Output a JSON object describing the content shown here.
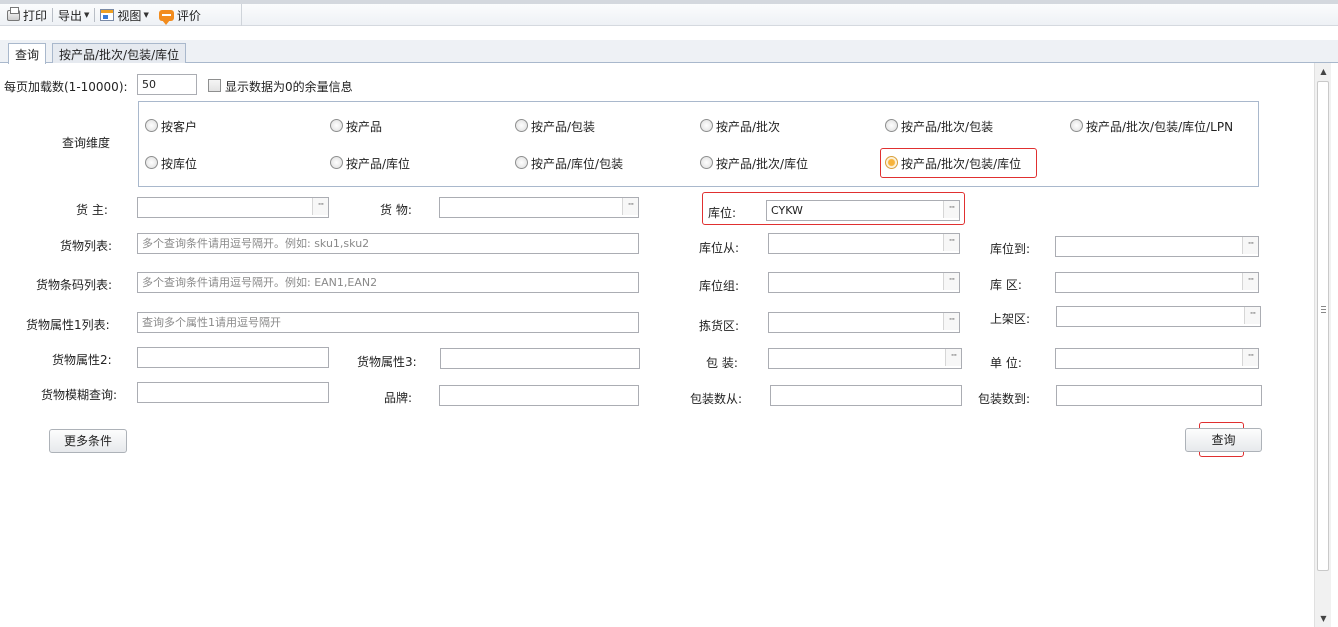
{
  "toolbar": {
    "print": "打印",
    "export": "导出",
    "view": "视图",
    "rate": "评价"
  },
  "tabs": [
    "查询",
    "按产品/批次/包装/库位"
  ],
  "page_size": {
    "label": "每页加载数(1-10000):",
    "value": "50"
  },
  "show_zero": {
    "label": "显示数据为0的余量信息",
    "checked": false
  },
  "dimension": {
    "label": "查询维度",
    "options": [
      "按客户",
      "按产品",
      "按产品/包装",
      "按产品/批次",
      "按产品/批次/包装",
      "按产品/批次/包装/库位/LPN",
      "按库位",
      "按产品/库位",
      "按产品/库位/包装",
      "按产品/批次/库位",
      "按产品/批次/包装/库位"
    ],
    "selected": "按产品/批次/包装/库位"
  },
  "fields": {
    "owner": {
      "label": "货 主:",
      "value": ""
    },
    "goods": {
      "label": "货 物:",
      "value": ""
    },
    "location": {
      "label": "库位:",
      "value": "CYKW"
    },
    "goods_list": {
      "label": "货物列表:",
      "placeholder": "多个查询条件请用逗号隔开。例如: sku1,sku2"
    },
    "location_from": {
      "label": "库位从:",
      "value": ""
    },
    "location_to": {
      "label": "库位到:",
      "value": ""
    },
    "barcode_list": {
      "label": "货物条码列表:",
      "placeholder": "多个查询条件请用逗号隔开。例如: EAN1,EAN2"
    },
    "location_group": {
      "label": "库位组:",
      "value": ""
    },
    "zone": {
      "label": "库 区:",
      "value": ""
    },
    "attr1_list": {
      "label": "货物属性1列表:",
      "placeholder": "查询多个属性1请用逗号隔开"
    },
    "picking_area": {
      "label": "拣货区:",
      "value": ""
    },
    "putaway_area": {
      "label": "上架区:",
      "value": ""
    },
    "attr2": {
      "label": "货物属性2:",
      "value": ""
    },
    "attr3": {
      "label": "货物属性3:",
      "value": ""
    },
    "package": {
      "label": "包 装:",
      "value": ""
    },
    "unit": {
      "label": "单 位:",
      "value": ""
    },
    "fuzzy": {
      "label": "货物模糊查询:",
      "value": ""
    },
    "brand": {
      "label": "品牌:",
      "value": ""
    },
    "pack_qty_from": {
      "label": "包装数从:",
      "value": ""
    },
    "pack_qty_to": {
      "label": "包装数到:",
      "value": ""
    }
  },
  "buttons": {
    "more": "更多条件",
    "query": "查询"
  },
  "colors": {
    "highlight_red": "#e03030",
    "radio_selected": "#f7b33b",
    "border_blue": "#a9b8cc"
  }
}
